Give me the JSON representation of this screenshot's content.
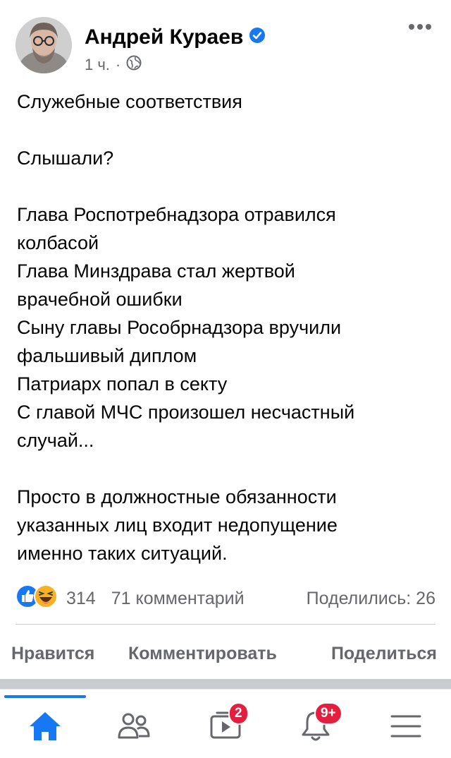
{
  "post": {
    "author": "Андрей Кураев",
    "time": "1 ч.",
    "separator": "·",
    "paragraphs": [
      [
        "Служебные соответствия"
      ],
      [
        "Слышали?"
      ],
      [
        "Глава Роспотребнадзора отравился",
        "колбасой",
        "Глава Минздрава стал жертвой",
        "врачебной ошибки",
        "Сыну главы Рособрнадзора вручили",
        "фальшивый диплом",
        "Патриарх попал в секту",
        "С главой МЧС произошел несчастный",
        "случай..."
      ],
      [
        "Просто в должностные обязанности",
        "указанных лиц входит недопущение",
        "именно таких ситуаций."
      ]
    ]
  },
  "stats": {
    "reactions_count": "314",
    "comments": "71 комментарий",
    "shares": "Поделились: 26"
  },
  "actions": {
    "like": "Нравится",
    "comment": "Комментировать",
    "share": "Поделиться"
  },
  "tabbar": {
    "watch_badge": "2",
    "notifications_badge": "9+"
  },
  "colors": {
    "accent": "#1877f2",
    "badge": "#e41e3f",
    "secondary_text": "#65676b"
  }
}
